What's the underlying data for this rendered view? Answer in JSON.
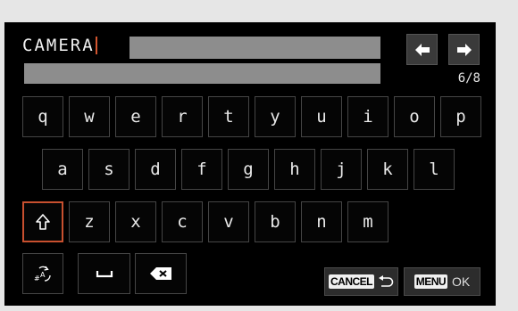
{
  "input": {
    "value": "CAMERA"
  },
  "page_indicator": "6/8",
  "keyboard": {
    "row1": [
      "q",
      "w",
      "e",
      "r",
      "t",
      "y",
      "u",
      "i",
      "o",
      "p"
    ],
    "row2": [
      "a",
      "s",
      "d",
      "f",
      "g",
      "h",
      "j",
      "k",
      "l"
    ],
    "row3": [
      "z",
      "x",
      "c",
      "v",
      "b",
      "n",
      "m"
    ]
  },
  "buttons": {
    "cancel_label": "CANCEL",
    "menu_label": "MENU",
    "ok_label": "OK"
  },
  "colors": {
    "accent": "#c8502f",
    "background": "#000000",
    "bezel": "#e6e6e6"
  }
}
